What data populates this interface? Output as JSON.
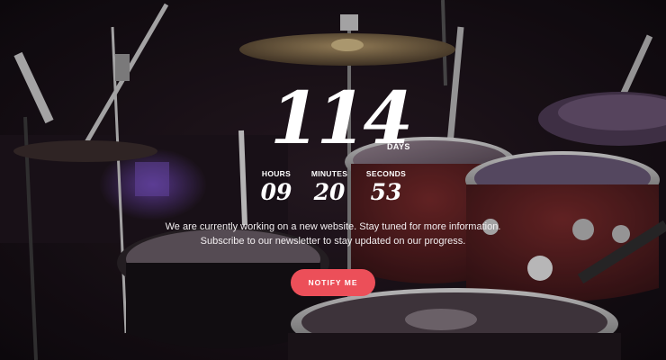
{
  "countdown": {
    "days": {
      "value": "114",
      "label": "DAYS"
    },
    "hours": {
      "value": "09",
      "label": "HOURS"
    },
    "minutes": {
      "value": "20",
      "label": "MINUTES"
    },
    "seconds": {
      "value": "53",
      "label": "SECONDS"
    }
  },
  "message": {
    "line1": "We are currently working on a new website. Stay tuned for more information.",
    "line2": "Subscribe to our newsletter to stay updated on our progress."
  },
  "notify_button": {
    "label": "NOTIFY ME"
  },
  "colors": {
    "accent": "#ec4f59",
    "background": "#150f14"
  }
}
